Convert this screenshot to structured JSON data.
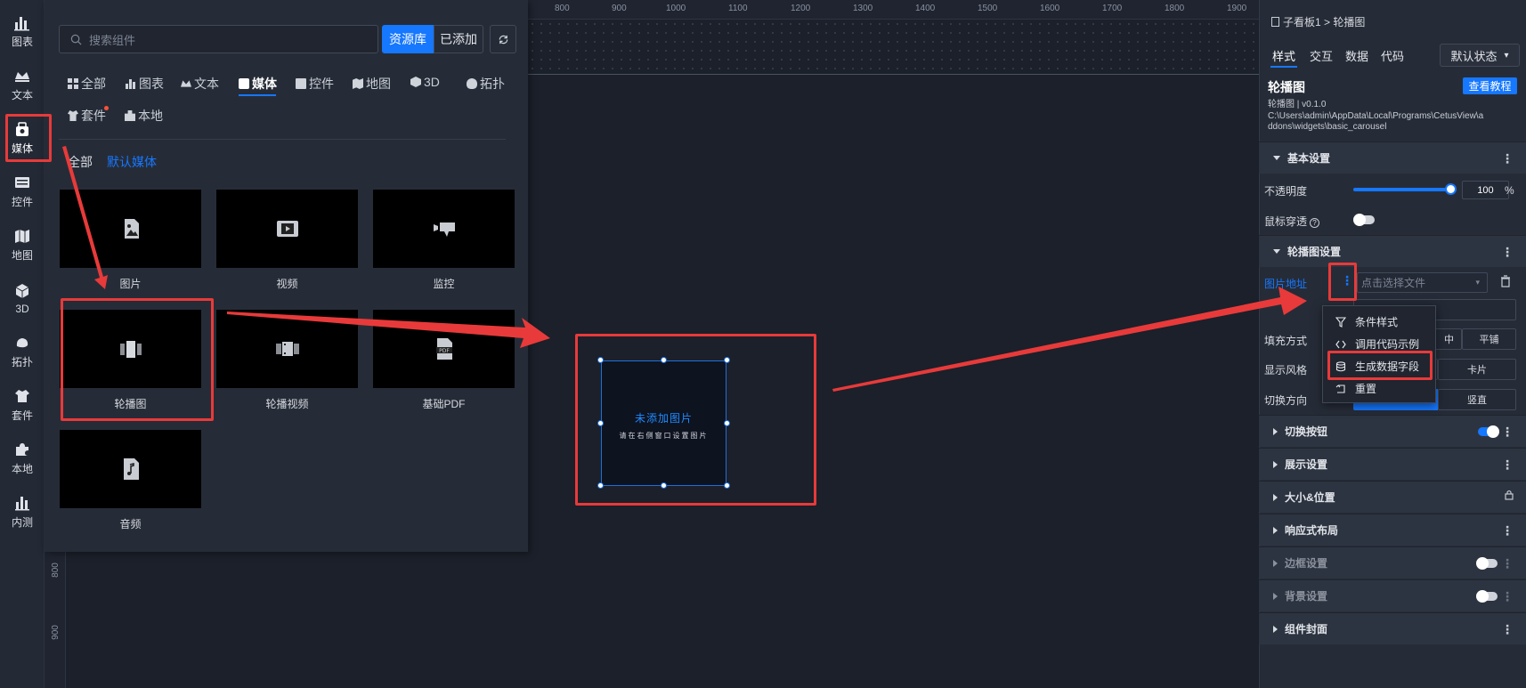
{
  "left_nav": [
    {
      "label": "图表",
      "icon": "chart-icon"
    },
    {
      "label": "文本",
      "icon": "text-icon"
    },
    {
      "label": "媒体",
      "icon": "media-icon"
    },
    {
      "label": "控件",
      "icon": "control-icon"
    },
    {
      "label": "地图",
      "icon": "map-icon"
    },
    {
      "label": "3D",
      "icon": "cube-icon"
    },
    {
      "label": "拓扑",
      "icon": "topology-icon"
    },
    {
      "label": "套件",
      "icon": "kit-icon"
    },
    {
      "label": "本地",
      "icon": "puzzle-icon"
    },
    {
      "label": "内测",
      "icon": "beta-icon"
    }
  ],
  "panel": {
    "search_placeholder": "搜索组件",
    "btn_library": "资源库",
    "btn_added": "已添加",
    "categories": [
      "全部",
      "图表",
      "文本",
      "媒体",
      "控件",
      "地图",
      "3D",
      "拓扑",
      "套件",
      "本地"
    ],
    "sub_tabs": [
      "全部",
      "默认媒体"
    ],
    "cards": [
      "图片",
      "视频",
      "监控",
      "轮播图",
      "轮播视频",
      "基础PDF",
      "音频"
    ]
  },
  "ruler": {
    "top": [
      "800",
      "900",
      "1000",
      "1100",
      "1200",
      "1300",
      "1400",
      "1500",
      "1600",
      "1700",
      "1800",
      "1900"
    ],
    "left": [
      "800",
      "900"
    ]
  },
  "widget": {
    "title": "未添加图片",
    "subtitle": "请在右侧窗口设置图片"
  },
  "right": {
    "crumb_parent": "子看板1",
    "crumb_sep": ">",
    "crumb_current": "轮播图",
    "tabs": [
      "样式",
      "交互",
      "数据",
      "代码"
    ],
    "state_select": "默认状态",
    "title": "轮播图",
    "tutorial_btn": "查看教程",
    "version": "轮播图 | v0.1.0",
    "path_line1": "C:\\Users\\admin\\AppData\\Local\\Programs\\CetusView\\a",
    "path_line2": "ddons\\widgets\\basic_carousel",
    "sec_basic": "基本设置",
    "opacity_label": "不透明度",
    "opacity_value": "100",
    "opacity_unit": "%",
    "mouse_label": "鼠标穿透",
    "sec_carousel": "轮播图设置",
    "img_addr_label": "图片地址",
    "file_placeholder": "点击选择文件",
    "fill_label": "填充方式",
    "fill_options": [
      "中",
      "平铺"
    ],
    "style_label": "显示风格",
    "style_option": "卡片",
    "dir_label": "切换方向",
    "dir_option": "竖直",
    "sec_switch": "切换按钮",
    "sec_display": "展示设置",
    "sec_size": "大小&位置",
    "sec_responsive": "响应式布局",
    "sec_border": "边框设置",
    "sec_bg": "背景设置",
    "sec_cover": "组件封面"
  },
  "context_menu": [
    "条件样式",
    "调用代码示例",
    "生成数据字段",
    "重置"
  ],
  "colors": {
    "accent": "#1677ff",
    "highlight": "#e83a3a"
  }
}
